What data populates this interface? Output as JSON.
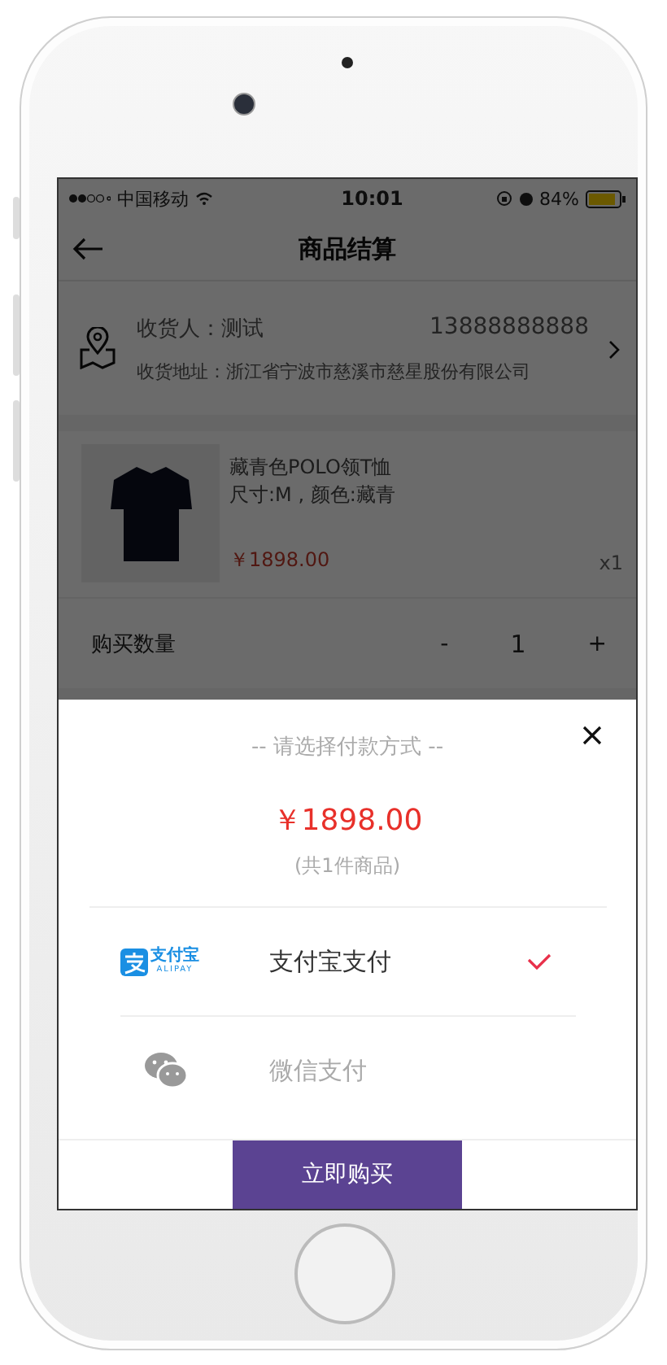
{
  "status_bar": {
    "carrier": "中国移动",
    "time": "10:01",
    "battery": "84%"
  },
  "nav": {
    "title": "商品结算"
  },
  "address": {
    "recipient": "收货人：测试",
    "phone": "13888888888",
    "address": "收货地址：浙江省宁波市慈溪市慈星股份有限公司"
  },
  "product": {
    "name": "藏青色POLO领T恤",
    "spec": "尺寸:M , 颜色:藏青",
    "price": "￥1898.00",
    "quantity": "x1"
  },
  "quantity_row": {
    "label": "购买数量",
    "decrement": "-",
    "value": "1",
    "increment": "+"
  },
  "payment_sheet": {
    "title": "-- 请选择付款方式 --",
    "amount": "￥1898.00",
    "count": "(共1件商品)",
    "methods": [
      {
        "kind": "alipay",
        "label": "支付宝支付",
        "selected": true,
        "logo_text": "支付宝",
        "logo_subtext": "ALIPAY"
      },
      {
        "kind": "wechat",
        "label": "微信支付",
        "selected": false
      }
    ],
    "button": "立即购买"
  }
}
